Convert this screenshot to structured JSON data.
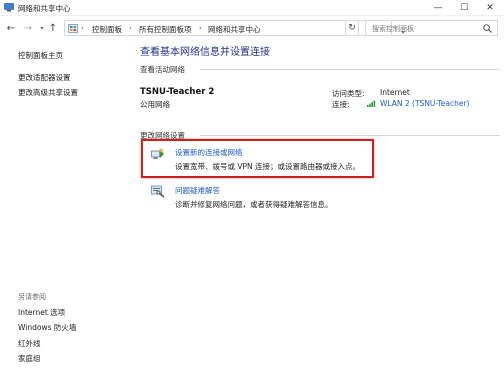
{
  "window": {
    "title": "网络和共享中心",
    "minimize": "—",
    "maximize": "☐",
    "close": "✕"
  },
  "address": {
    "back": "←",
    "forward": "→",
    "up": "↑",
    "crumbs": [
      "控制面板",
      "所有控制面板项",
      "网络和共享中心"
    ],
    "refresh": "↻",
    "search_placeholder": "搜索控制面板"
  },
  "sidebar": {
    "links": [
      "控制面板主页",
      "更改适配器设置",
      "更改高级共享设置"
    ],
    "see_also_heading": "另请参阅",
    "see_also": [
      "Internet 选项",
      "Windows 防火墙",
      "红外线",
      "家庭组"
    ]
  },
  "main": {
    "title": "查看基本网络信息并设置连接",
    "active_networks_label": "查看活动网络",
    "network_name": "TSNU-Teacher  2",
    "network_type": "公用网络",
    "access_type_label": "访问类型:",
    "access_type_value": "Internet",
    "connections_label": "连接:",
    "connections_value": "WLAN 2 (TSNU-Teacher)",
    "change_settings_label": "更改网络设置",
    "tasks": [
      {
        "link": "设置新的连接或网络",
        "desc": "设置宽带、拨号或 VPN 连接；或设置路由器或接入点。"
      },
      {
        "link": "问题疑难解答",
        "desc": "诊断并修复网络问题，或者获得疑难解答信息。"
      }
    ]
  },
  "colors": {
    "link": "#1a5ad6",
    "title": "#1e3287",
    "highlight": "#cc1f1f"
  }
}
